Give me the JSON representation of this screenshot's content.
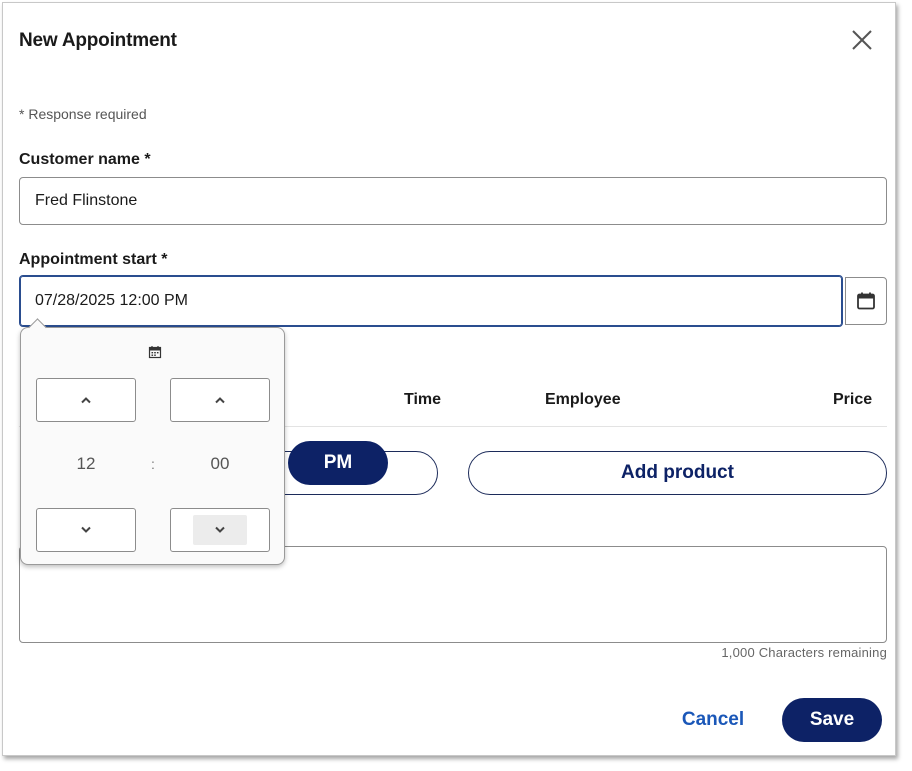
{
  "dialog": {
    "title": "New Appointment",
    "required_note": "* Response required"
  },
  "form": {
    "customer_label": "Customer name *",
    "customer_value": "Fred Flinstone",
    "start_label": "Appointment start *",
    "start_value": "07/28/2025 12:00 PM"
  },
  "table": {
    "columns": [
      "Time",
      "Employee",
      "Price"
    ]
  },
  "buttons": {
    "pm": "PM",
    "add_product": "Add product",
    "cancel": "Cancel",
    "save": "Save"
  },
  "notes": {
    "chars_remaining": "1,000 Characters remaining"
  },
  "time_picker": {
    "hour": "12",
    "separator": ":",
    "minute": "00"
  },
  "colors": {
    "primary": "#0d2266",
    "link": "#1a57b8",
    "focus_border": "#2a4d8f"
  },
  "icons": {
    "close": "close-icon",
    "calendar": "calendar-icon",
    "up": "chevron-up-icon",
    "down": "chevron-down-icon"
  }
}
